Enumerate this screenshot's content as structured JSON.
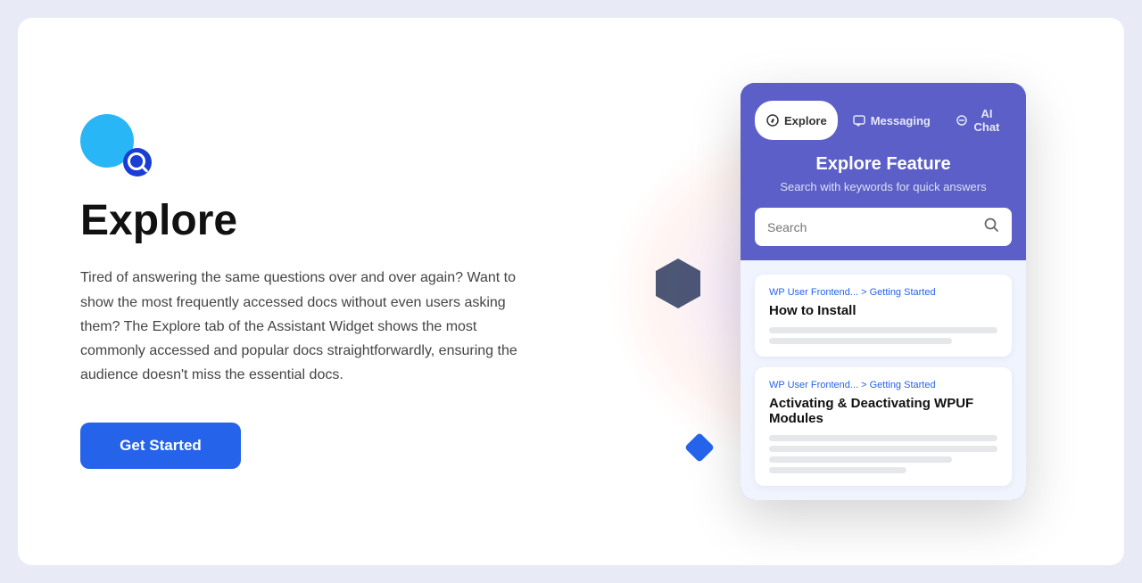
{
  "card": {
    "logo": {
      "big_circle_color": "#29b6f6",
      "search_color": "#1a3ed4"
    },
    "left": {
      "title": "Explore",
      "description": "Tired of answering the same questions over and over again? Want to show the most frequently accessed docs without even users asking them? The Explore tab of the Assistant Widget shows the most commonly accessed and popular docs straightforwardly, ensuring the audience doesn't miss the essential docs.",
      "cta_label": "Get Started"
    },
    "widget": {
      "tabs": [
        {
          "id": "explore",
          "label": "Explore",
          "active": true,
          "icon": "compass"
        },
        {
          "id": "messaging",
          "label": "Messaging",
          "active": false,
          "icon": "chat"
        },
        {
          "id": "ai-chat",
          "label": "AI Chat",
          "active": false,
          "icon": "bot"
        }
      ],
      "title": "Explore Feature",
      "subtitle": "Search with keywords for quick answers",
      "search_placeholder": "Search",
      "doc_cards": [
        {
          "breadcrumb": "WP User Frontend... > Getting Started",
          "title": "How to Install",
          "lines": [
            "full",
            "medium",
            "short"
          ]
        },
        {
          "breadcrumb": "WP User Frontend... > Getting Started",
          "title": "Activating & Deactivating WPUF Modules",
          "lines": [
            "full",
            "full",
            "medium",
            "short"
          ]
        }
      ]
    }
  }
}
